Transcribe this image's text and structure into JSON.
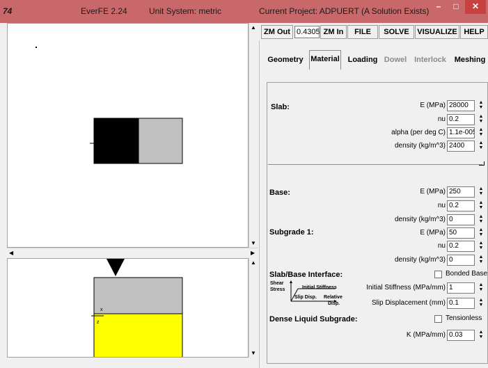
{
  "window": {
    "app_icon": "74",
    "app_title": "EverFE 2.24",
    "unit_system": "Unit System: metric",
    "project": "Current Project: ADPUERT (A Solution Exists)",
    "minimize": "–",
    "maximize": "□",
    "close": "✕"
  },
  "toolbar": {
    "zoom_out": "ZM Out",
    "zoom_value": "0.4305",
    "zoom_in": "ZM In",
    "file": "FILE",
    "solve": "SOLVE",
    "visualize": "VISUALIZE",
    "help": "HELP"
  },
  "tabs": [
    {
      "label": "Geometry",
      "enabled": true
    },
    {
      "label": "Material",
      "enabled": true,
      "active": true
    },
    {
      "label": "Loading",
      "enabled": true
    },
    {
      "label": "Dowel",
      "enabled": false
    },
    {
      "label": "Interlock",
      "enabled": false
    },
    {
      "label": "Meshing",
      "enabled": true
    }
  ],
  "slab": {
    "title": "Slab:",
    "e_label": "E (MPa)",
    "e_value": "28000",
    "nu_label": "nu",
    "nu_value": "0.2",
    "alpha_label": "alpha (per deg C)",
    "alpha_value": "1.1e-005",
    "density_label": "density (kg/m^3)",
    "density_value": "2400"
  },
  "base": {
    "title": "Base:",
    "e_label": "E (MPa)",
    "e_value": "250",
    "nu_label": "nu",
    "nu_value": "0.2",
    "density_label": "density (kg/m^3)",
    "density_value": "0"
  },
  "subgrade": {
    "title": "Subgrade 1:",
    "e_label": "E (MPa)",
    "e_value": "50",
    "nu_label": "nu",
    "nu_value": "0.2",
    "density_label": "density (kg/m^3)",
    "density_value": "0"
  },
  "interface": {
    "title": "Slab/Base Interface:",
    "bonded_label": "Bonded Base",
    "diagram_shear": "Shear",
    "diagram_stress": "Stress",
    "diagram_initial": "Initial Stiffness",
    "diagram_slip": "Slip Disp.",
    "diagram_relative": "Relative",
    "diagram_disp": "Disp.",
    "stiffness_label": "Initial Stiffness (MPa/mm)",
    "stiffness_value": "1",
    "slip_label": "Slip Displacement (mm)",
    "slip_value": "0.1"
  },
  "dense_liquid": {
    "title": "Dense Liquid Subgrade:",
    "tensionless_label": "Tensionless",
    "k_label": "K (MPa/mm)",
    "k_value": "0.03"
  },
  "side_view": {
    "axis_x": "x",
    "axis_z": "z"
  },
  "colors": {
    "titlebar": "#c9686a",
    "slab_black": "#000000",
    "slab_grey": "#c0c0c0",
    "subgrade_yellow": "#ffff00"
  }
}
